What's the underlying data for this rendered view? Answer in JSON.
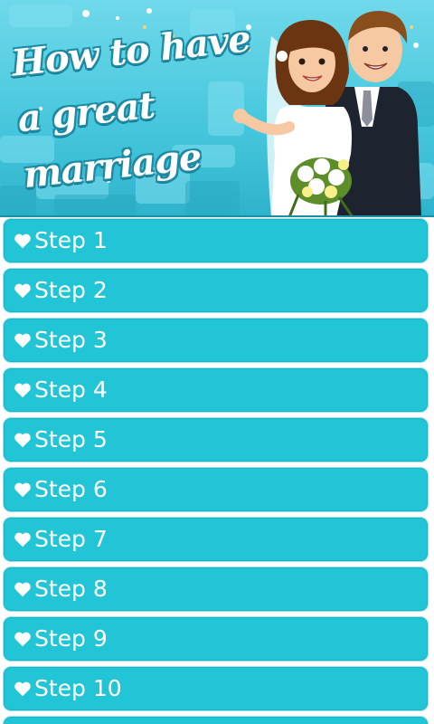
{
  "banner": {
    "title": "How to have a great marriage"
  },
  "steps": {
    "icon": "heart-icon",
    "items": [
      {
        "label": "Step 1"
      },
      {
        "label": "Step 2"
      },
      {
        "label": "Step 3"
      },
      {
        "label": "Step 4"
      },
      {
        "label": "Step 5"
      },
      {
        "label": "Step 6"
      },
      {
        "label": "Step 7"
      },
      {
        "label": "Step 8"
      },
      {
        "label": "Step 9"
      },
      {
        "label": "Step 10"
      }
    ]
  },
  "colors": {
    "item_background": "#22c5d6",
    "item_border": "#9fe5ee",
    "banner_background": "#45c6dc",
    "text": "#ffffff"
  }
}
